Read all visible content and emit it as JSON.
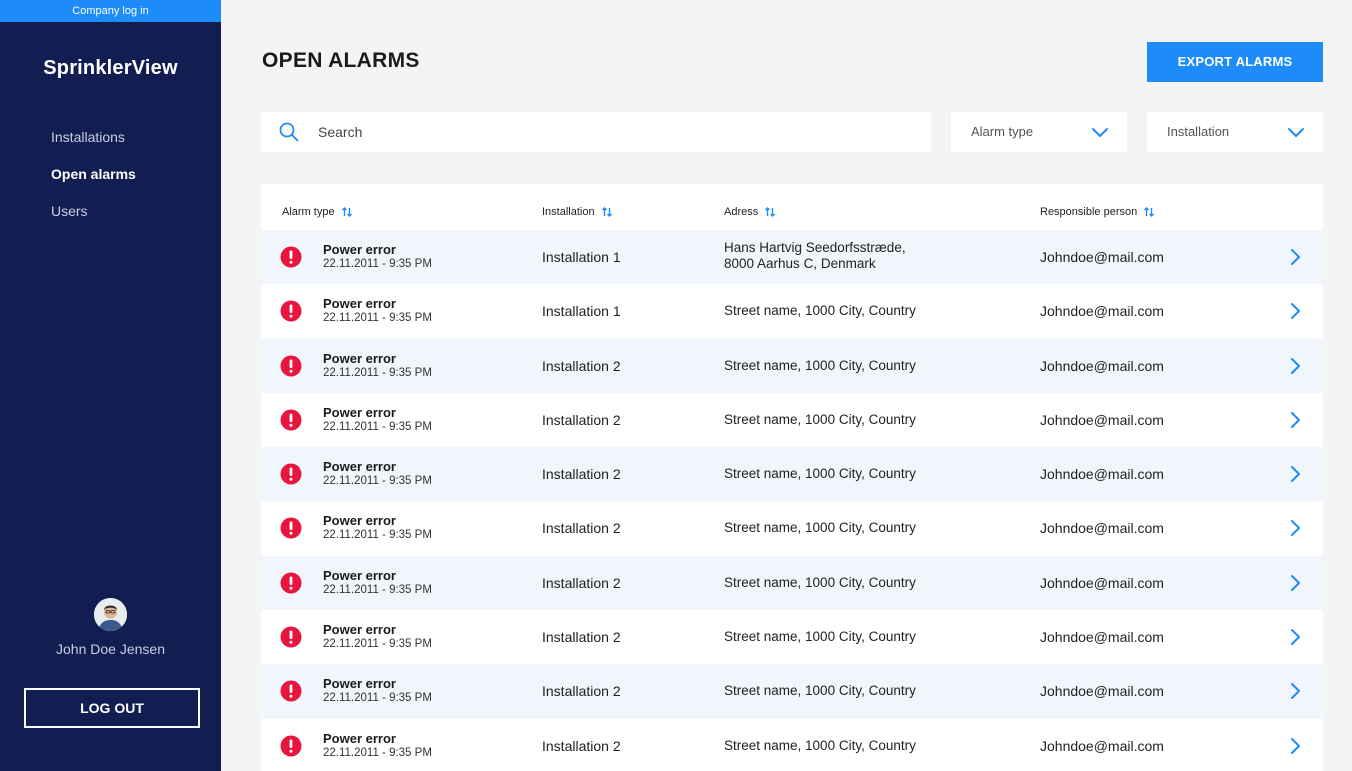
{
  "colors": {
    "sidebar": "#121e52",
    "accent": "#1d8cf8",
    "alert": "#e8163e",
    "row_alt": "#f1f5fc"
  },
  "sidebar": {
    "company_login": "Company log in",
    "brand": "SprinklerView",
    "nav": [
      {
        "label": "Installations",
        "active": false
      },
      {
        "label": "Open alarms",
        "active": true
      },
      {
        "label": "Users",
        "active": false
      }
    ],
    "user_name": "John Doe Jensen",
    "logout_label": "LOG OUT"
  },
  "header": {
    "title": "OPEN ALARMS",
    "export_label": "EXPORT ALARMS"
  },
  "filters": {
    "search_placeholder": "Search",
    "alarm_type_label": "Alarm type",
    "installation_label": "Installation"
  },
  "table": {
    "columns": [
      "Alarm type",
      "Installation",
      "Adress",
      "Responsible person"
    ],
    "rows": [
      {
        "alarm": "Power error",
        "time": "22.11.2011 - 9:35 PM",
        "installation": "Installation 1",
        "address_line1": "Hans Hartvig Seedorfsstræde,",
        "address_line2": "8000 Aarhus C, Denmark",
        "responsible": "Johndoe@mail.com"
      },
      {
        "alarm": "Power error",
        "time": "22.11.2011 - 9:35 PM",
        "installation": "Installation 1",
        "address_line1": "Street name, 1000 City, Country",
        "address_line2": "",
        "responsible": "Johndoe@mail.com"
      },
      {
        "alarm": "Power error",
        "time": "22.11.2011 - 9:35 PM",
        "installation": "Installation 2",
        "address_line1": "Street name, 1000 City, Country",
        "address_line2": "",
        "responsible": "Johndoe@mail.com"
      },
      {
        "alarm": "Power error",
        "time": "22.11.2011 - 9:35 PM",
        "installation": "Installation 2",
        "address_line1": "Street name, 1000 City, Country",
        "address_line2": "",
        "responsible": "Johndoe@mail.com"
      },
      {
        "alarm": "Power error",
        "time": "22.11.2011 - 9:35 PM",
        "installation": "Installation 2",
        "address_line1": "Street name, 1000 City, Country",
        "address_line2": "",
        "responsible": "Johndoe@mail.com"
      },
      {
        "alarm": "Power error",
        "time": "22.11.2011 - 9:35 PM",
        "installation": "Installation 2",
        "address_line1": "Street name, 1000 City, Country",
        "address_line2": "",
        "responsible": "Johndoe@mail.com"
      },
      {
        "alarm": "Power error",
        "time": "22.11.2011 - 9:35 PM",
        "installation": "Installation 2",
        "address_line1": "Street name, 1000 City, Country",
        "address_line2": "",
        "responsible": "Johndoe@mail.com"
      },
      {
        "alarm": "Power error",
        "time": "22.11.2011 - 9:35 PM",
        "installation": "Installation 2",
        "address_line1": "Street name, 1000 City, Country",
        "address_line2": "",
        "responsible": "Johndoe@mail.com"
      },
      {
        "alarm": "Power error",
        "time": "22.11.2011 - 9:35 PM",
        "installation": "Installation 2",
        "address_line1": "Street name, 1000 City, Country",
        "address_line2": "",
        "responsible": "Johndoe@mail.com"
      },
      {
        "alarm": "Power error",
        "time": "22.11.2011 - 9:35 PM",
        "installation": "Installation 2",
        "address_line1": "Street name, 1000 City, Country",
        "address_line2": "",
        "responsible": "Johndoe@mail.com"
      }
    ]
  },
  "icons": {
    "search": "search-icon",
    "chevron_down": "chevron-down-icon",
    "chevron_right": "chevron-right-icon",
    "alert": "alert-icon",
    "sort": "sort-icon",
    "avatar": "avatar"
  }
}
